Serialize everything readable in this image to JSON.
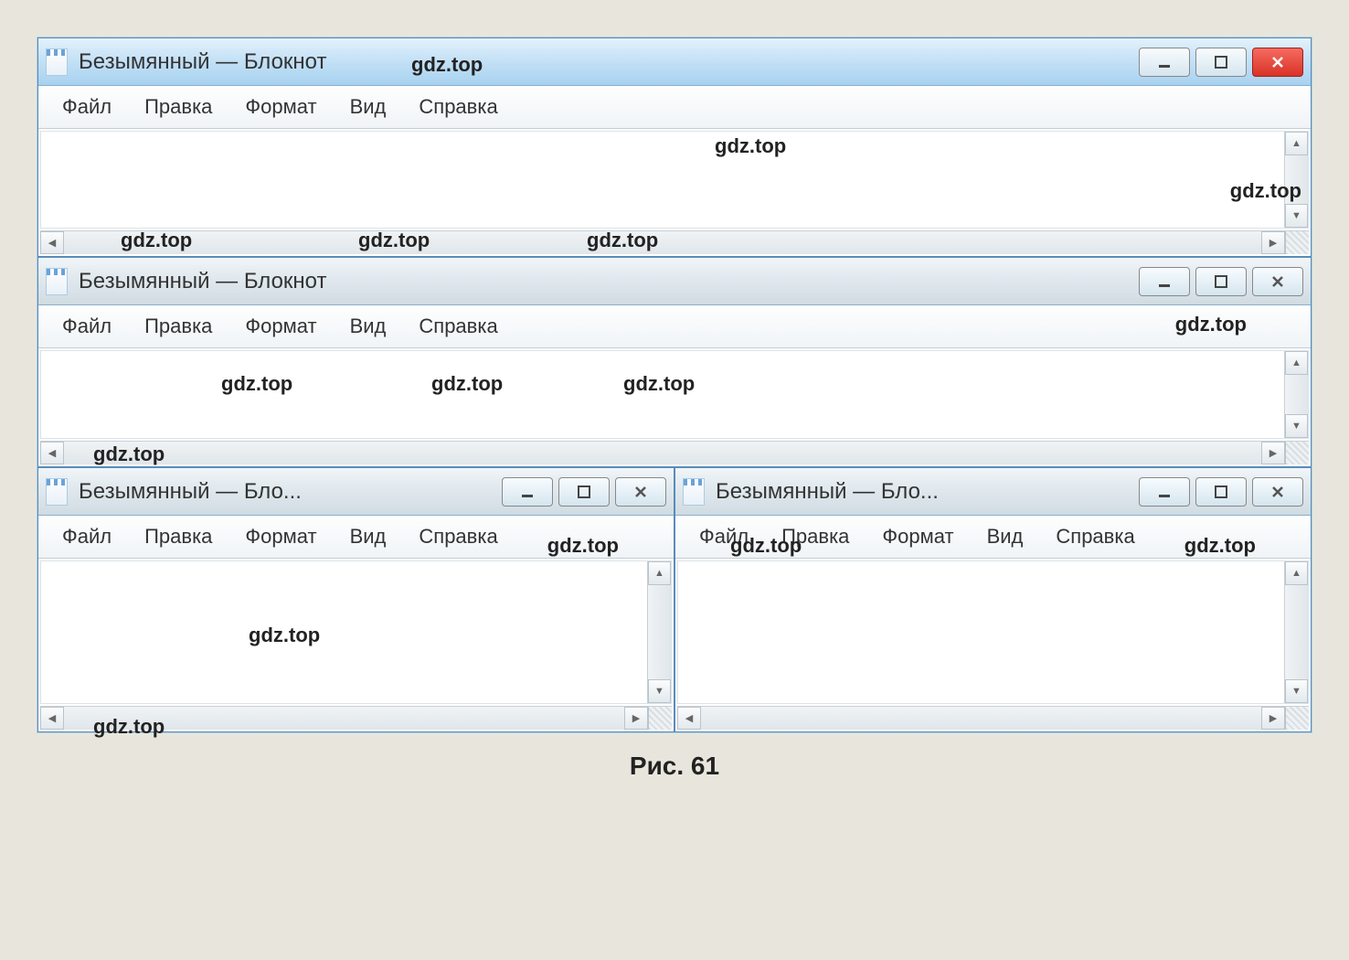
{
  "caption": "Рис. 61",
  "watermark_text": "gdz.top",
  "windows": [
    {
      "title": "Безымянный — Блокнот",
      "active": true,
      "close_style": "red",
      "menus": [
        "Файл",
        "Правка",
        "Формат",
        "Вид",
        "Справка"
      ]
    },
    {
      "title": "Безымянный — Блокнот",
      "active": false,
      "close_style": "normal",
      "menus": [
        "Файл",
        "Правка",
        "Формат",
        "Вид",
        "Справка"
      ]
    },
    {
      "title": "Безымянный — Бло...",
      "active": false,
      "close_style": "normal",
      "menus": [
        "Файл",
        "Правка",
        "Формат",
        "Вид",
        "Справка"
      ]
    },
    {
      "title": "Безымянный — Бло...",
      "active": false,
      "close_style": "normal",
      "menus": [
        "Файл",
        "Правка",
        "Формат",
        "Вид",
        "Справка"
      ]
    }
  ],
  "icons": {
    "minimize": "minimize",
    "maximize": "maximize",
    "close": "close"
  }
}
